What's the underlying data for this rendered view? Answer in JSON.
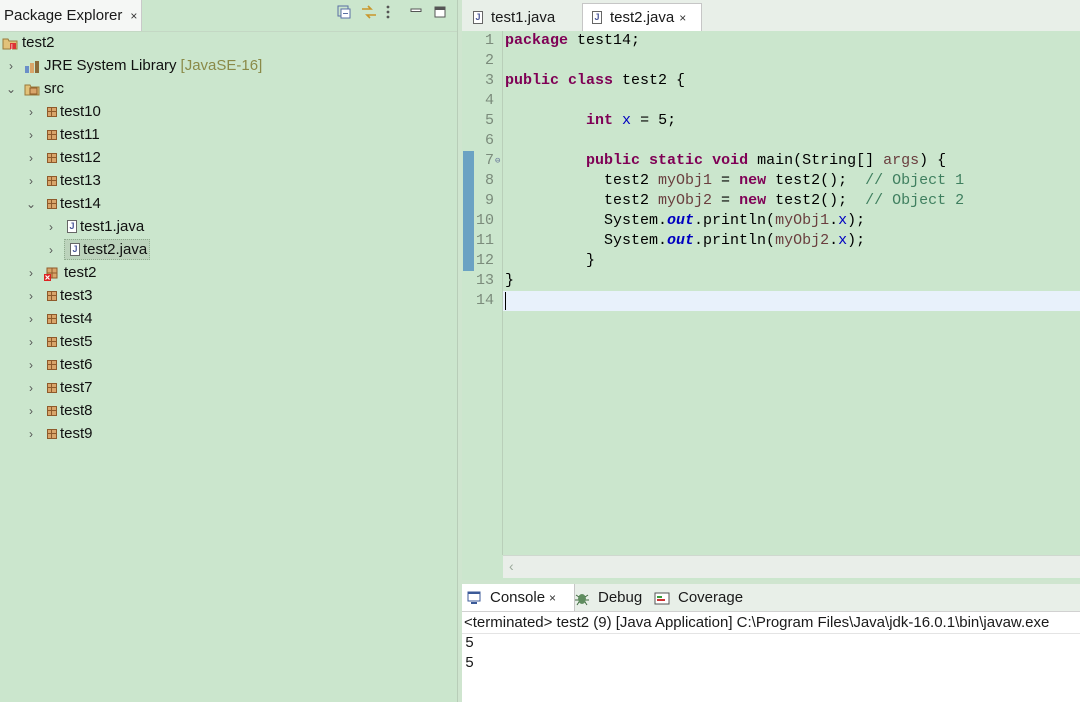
{
  "explorer": {
    "title": "Package Explorer",
    "close": "×",
    "tree": [
      {
        "label": "test2",
        "depth": 0,
        "twisty": "",
        "icon": "project-icon"
      },
      {
        "label": "JRE System Library",
        "decor": "[JavaSE-16]",
        "depth": 1,
        "twisty": "›",
        "icon": "library-icon"
      },
      {
        "label": "src",
        "depth": 1,
        "twisty": "⌄",
        "icon": "source-folder-icon"
      },
      {
        "label": "test10",
        "depth": 2,
        "twisty": "›",
        "icon": "package-icon"
      },
      {
        "label": "test11",
        "depth": 2,
        "twisty": "›",
        "icon": "package-icon"
      },
      {
        "label": "test12",
        "depth": 2,
        "twisty": "›",
        "icon": "package-icon"
      },
      {
        "label": "test13",
        "depth": 2,
        "twisty": "›",
        "icon": "package-icon"
      },
      {
        "label": "test14",
        "depth": 2,
        "twisty": "⌄",
        "icon": "package-icon"
      },
      {
        "label": "test1.java",
        "depth": 3,
        "twisty": "›",
        "icon": "java-file-icon"
      },
      {
        "label": "test2.java",
        "depth": 3,
        "twisty": "›",
        "icon": "java-file-icon",
        "selected": true
      },
      {
        "label": "test2",
        "depth": 2,
        "twisty": "›",
        "icon": "package-error-icon"
      },
      {
        "label": "test3",
        "depth": 2,
        "twisty": "›",
        "icon": "package-icon"
      },
      {
        "label": "test4",
        "depth": 2,
        "twisty": "›",
        "icon": "package-icon"
      },
      {
        "label": "test5",
        "depth": 2,
        "twisty": "›",
        "icon": "package-icon"
      },
      {
        "label": "test6",
        "depth": 2,
        "twisty": "›",
        "icon": "package-icon"
      },
      {
        "label": "test7",
        "depth": 2,
        "twisty": "›",
        "icon": "package-icon"
      },
      {
        "label": "test8",
        "depth": 2,
        "twisty": "›",
        "icon": "package-icon"
      },
      {
        "label": "test9",
        "depth": 2,
        "twisty": "›",
        "icon": "package-icon"
      }
    ]
  },
  "editor": {
    "tabs": [
      {
        "label": "test1.java",
        "active": false
      },
      {
        "label": "test2.java",
        "active": true,
        "close": "×"
      }
    ],
    "line_numbers": [
      "1",
      "2",
      "3",
      "4",
      "5",
      "6",
      "7",
      "8",
      "9",
      "10",
      "11",
      "12",
      "13",
      "14"
    ],
    "fold_marker": "⊖"
  },
  "console": {
    "tabs": [
      {
        "label": "Console",
        "close": "×",
        "active": true
      },
      {
        "label": "Debug",
        "active": false
      },
      {
        "label": "Coverage",
        "active": false
      }
    ],
    "status": "<terminated> test2 (9) [Java Application] C:\\Program Files\\Java\\jdk-16.0.1\\bin\\javaw.exe",
    "output": [
      "5",
      "5"
    ]
  }
}
